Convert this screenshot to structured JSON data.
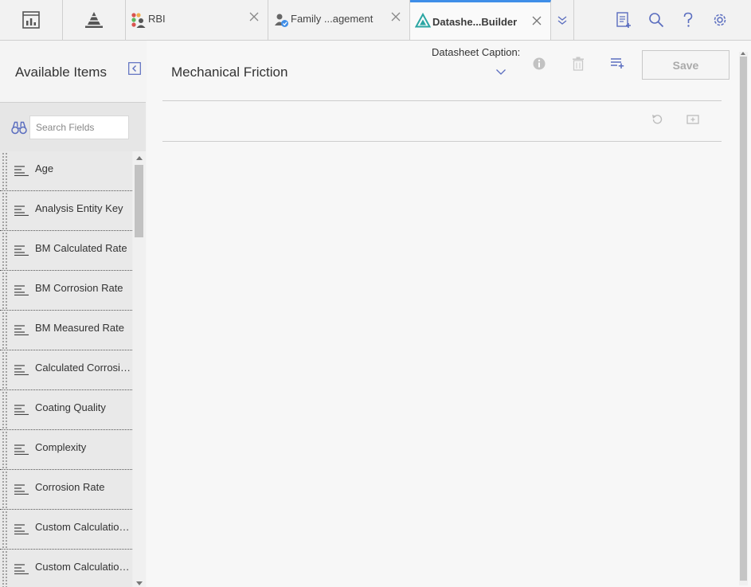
{
  "topbar": {
    "tabs": [
      {
        "label": "RBI",
        "icon": "rbi-icon"
      },
      {
        "label": "Family ...agement",
        "icon": "family-management-icon"
      },
      {
        "label": "Datashe...Builder",
        "icon": "datasheet-builder-icon",
        "active": true
      }
    ],
    "icons": [
      "dashboard-icon",
      "pyramid-icon",
      "chevron-down-icon",
      "new-document-icon",
      "search-icon",
      "help-icon",
      "settings-icon"
    ],
    "accent_color": "#3f8ee8",
    "icon_color": "#5a6dbf"
  },
  "sidebar": {
    "title": "Available Items",
    "search_placeholder": "Search Fields",
    "items": [
      {
        "label": "Age"
      },
      {
        "label": "Analysis Entity Key"
      },
      {
        "label": "BM Calculated Rate"
      },
      {
        "label": "BM Corrosion Rate"
      },
      {
        "label": "BM Measured Rate"
      },
      {
        "label": "Calculated Corrosion Rate"
      },
      {
        "label": "Coating Quality"
      },
      {
        "label": "Complexity"
      },
      {
        "label": "Corrosion Rate"
      },
      {
        "label": "Custom Calculation Parameter"
      },
      {
        "label": "Custom Calculation Units"
      }
    ]
  },
  "main": {
    "title": "Mechanical Friction",
    "caption_label": "Datasheet Caption:",
    "save_label": "Save"
  }
}
